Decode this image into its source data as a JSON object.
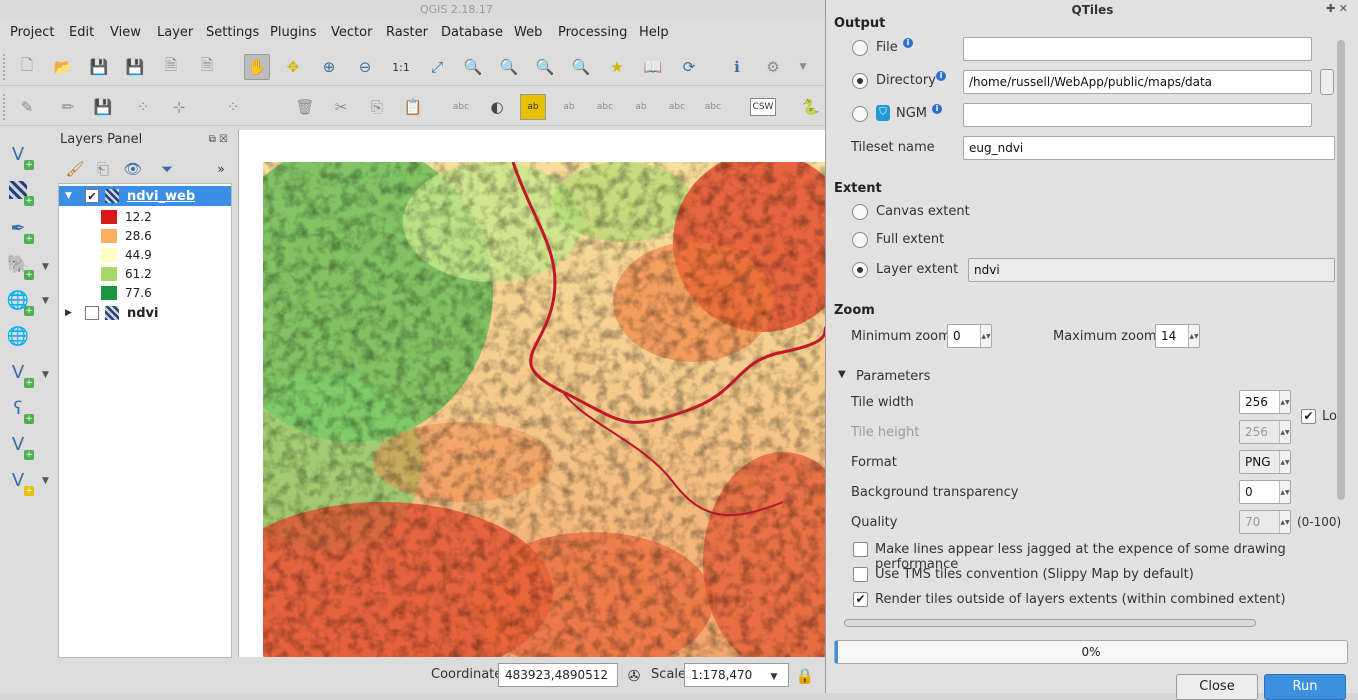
{
  "qgis": {
    "title": "QGIS 2.18.17",
    "menu": [
      "Project",
      "Edit",
      "View",
      "Layer",
      "Settings",
      "Plugins",
      "Vector",
      "Raster",
      "Database",
      "Web",
      "Processing",
      "Help"
    ],
    "layers_panel": {
      "title": "Layers Panel",
      "layers": [
        {
          "name": "ndvi_web",
          "checked": true,
          "selected": true,
          "expanded": true,
          "legend": [
            {
              "value": "12.2",
              "color": "#d7191c"
            },
            {
              "value": "28.6",
              "color": "#fdae61"
            },
            {
              "value": "44.9",
              "color": "#ffffbf"
            },
            {
              "value": "61.2",
              "color": "#a6d96a"
            },
            {
              "value": "77.6",
              "color": "#1a9641"
            }
          ]
        },
        {
          "name": "ndvi",
          "checked": false,
          "selected": false,
          "expanded": false
        }
      ]
    },
    "status": {
      "coordinate_label": "Coordinate",
      "coordinate_value": "483923,4890512",
      "scale_label": "Scale",
      "scale_value": "1:178,470"
    },
    "toolbar": {
      "csw_label": "CSW",
      "abc_label": "abc"
    }
  },
  "qtiles": {
    "title": "QTiles",
    "output": {
      "heading": "Output",
      "file_label": "File",
      "directory_label": "Directory",
      "directory_value": "/home/russell/WebApp/public/maps/data",
      "ngm_label": "NGM",
      "tileset_label": "Tileset name",
      "tileset_value": "eug_ndvi",
      "selected": "Directory"
    },
    "extent": {
      "heading": "Extent",
      "canvas_label": "Canvas extent",
      "full_label": "Full extent",
      "layer_label": "Layer extent",
      "layer_value": "ndvi",
      "selected": "Layer extent"
    },
    "zoom": {
      "heading": "Zoom",
      "min_label": "Minimum zoom",
      "min_value": "0",
      "max_label": "Maximum zoom",
      "max_value": "14"
    },
    "parameters": {
      "heading": "Parameters",
      "tile_width_label": "Tile width",
      "tile_width_value": "256",
      "lock_label": "Lo",
      "tile_height_label": "Tile height",
      "tile_height_value": "256",
      "format_label": "Format",
      "format_value": "PNG",
      "bg_label": "Background transparency",
      "bg_value": "0",
      "quality_label": "Quality",
      "quality_value": "70",
      "quality_range": "(0-100)",
      "antialias_label": "Make lines appear less jagged at the expence of some drawing performance",
      "antialias_checked": false,
      "tms_label": "Use TMS tiles convention (Slippy Map by default)",
      "tms_checked": false,
      "outside_label": "Render tiles outside of layers extents (within combined extent)",
      "outside_checked": true
    },
    "progress": {
      "label": "0%",
      "value": 0
    },
    "buttons": {
      "close": "Close",
      "run": "Run"
    }
  }
}
